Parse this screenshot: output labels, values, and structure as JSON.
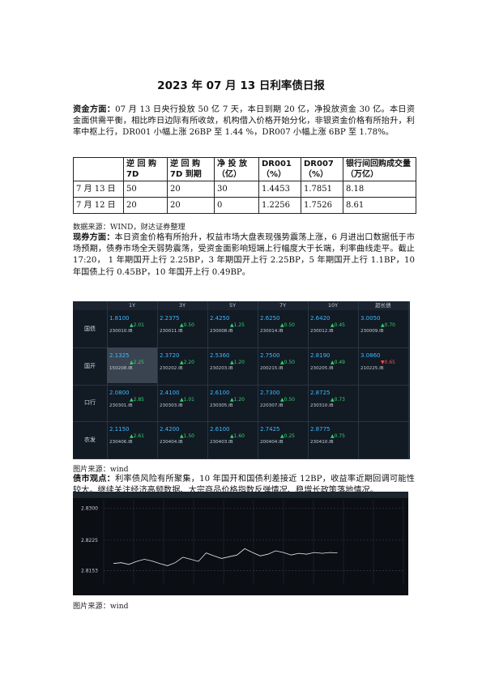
{
  "title": "2023 年 07 月 13 日利率债日报",
  "funds": {
    "lead": "资金方面：",
    "text": "07 月 13 日央行投放 50 亿 7 天，本日到期 20 亿，净投放资金 30 亿。本日资金面供需平衡，相比昨日边际有所收敛，机构借入价格开始分化，非银资金价格有所抬升，利率中枢上行，DR001 小幅上涨 26BP 至 1.44 %，DR007 小幅上涨 6BP 至 1.78%。"
  },
  "rates_table": {
    "headers": [
      "",
      "逆 回 购 7D",
      "逆 回 购 7D 到期",
      "净 投 放（亿）",
      "DR001（%）",
      "DR007（%）",
      "银行间回购成交量（万亿）"
    ],
    "rows": [
      [
        "7 月 13 日",
        "50",
        "20",
        "30",
        "1.4453",
        "1.7851",
        "8.18"
      ],
      [
        "7 月 12 日",
        "20",
        "20",
        "0",
        "1.2256",
        "1.7526",
        "8.61"
      ]
    ]
  },
  "source1": "数据来源：WIND，财达证券整理",
  "spot": {
    "lead": "现券方面：",
    "text": "本日资金价格有所抬升，权益市场大盘表现强势震荡上涨，6 月进出口数据低于市场预期，债券市场全天弱势震荡，受资金面影响短端上行幅度大于长端，利率曲线走平。截止 17:20， 1 年期国开上行 2.25BP，3 年期国开上行 2.25BP，5 年期国开上行 1.1BP，10 年国债上行 0.45BP，10 年国开上行 0.49BP。"
  },
  "quote_panel": {
    "columns": [
      "1Y",
      "3Y",
      "5Y",
      "7Y",
      "10Y",
      "超长债"
    ],
    "rows": [
      {
        "label": "国债",
        "cells": [
          {
            "yield": "1.8100",
            "change": "▲2.01",
            "code": "230010.IB"
          },
          {
            "yield": "2.2375",
            "change": "▲0.50",
            "code": "230011.IB"
          },
          {
            "yield": "2.4250",
            "change": "▲1.25",
            "code": "230008.IB"
          },
          {
            "yield": "2.6250",
            "change": "▲0.50",
            "code": "230014.IB"
          },
          {
            "yield": "2.6420",
            "change": "▲0.45",
            "code": "230012.IB"
          },
          {
            "yield": "3.0050",
            "change": "▲0.70",
            "code": "230009.IB"
          }
        ]
      },
      {
        "label": "国开",
        "cells": [
          {
            "yield": "2.1325",
            "change": "▲2.25",
            "code": "150208.IB"
          },
          {
            "yield": "2.3720",
            "change": "▲2.20",
            "code": "230202.IB"
          },
          {
            "yield": "2.5360",
            "change": "▲1.20",
            "code": "230203.IB"
          },
          {
            "yield": "2.7500",
            "change": "▲0.50",
            "code": "200215.IB"
          },
          {
            "yield": "2.8190",
            "change": "▲0.49",
            "code": "230205.IB"
          },
          {
            "yield": "3.0860",
            "change": "▼0.65",
            "code": "210225.IB"
          }
        ]
      },
      {
        "label": "口行",
        "cells": [
          {
            "yield": "2.0800",
            "change": "▲2.85",
            "code": "230301.IB"
          },
          {
            "yield": "2.4100",
            "change": "▲1.01",
            "code": "230303.IB"
          },
          {
            "yield": "2.6100",
            "change": "▲1.20",
            "code": "230305.IB"
          },
          {
            "yield": "2.7300",
            "change": "▲0.50",
            "code": "220307.IB"
          },
          {
            "yield": "2.8725",
            "change": "▲0.73",
            "code": "230310.IB"
          }
        ]
      },
      {
        "label": "农发",
        "cells": [
          {
            "yield": "2.1150",
            "change": "▲2.61",
            "code": "230406.IB"
          },
          {
            "yield": "2.4200",
            "change": "▲1.50",
            "code": "230404.IB"
          },
          {
            "yield": "2.6100",
            "change": "▲1.60",
            "code": "230403.IB"
          },
          {
            "yield": "2.7425",
            "change": "▲0.25",
            "code": "200404.IB"
          },
          {
            "yield": "2.8775",
            "change": "▲0.75",
            "code": "230410.IB"
          }
        ]
      }
    ]
  },
  "source2": "图片来源：wind",
  "view": {
    "lead": "债市观点：",
    "text": "利率债风险有所聚集，10 年国开和国债利差接近 12BP，收益率近期回调可能性较大。继续关注经济高频数据、大宗商品价格指数反弹情况、稳增长政策落地情况。"
  },
  "chart_data": {
    "type": "line",
    "title": "",
    "ylabel": "",
    "xlabel": "",
    "y_ticks": [
      "2.8300",
      "2.8225",
      "2.8153"
    ],
    "ylim": [
      2.812,
      2.832
    ],
    "grid": true,
    "series": [
      {
        "values": [
          2.817,
          2.8172,
          2.8168,
          2.8175,
          2.818,
          2.8176,
          2.817,
          2.8165,
          2.8172,
          2.8185,
          2.818,
          2.8175,
          2.8195,
          2.8188,
          2.8182,
          2.8186,
          2.819,
          2.8205,
          2.8196,
          2.8188,
          2.8192,
          2.82,
          2.8196,
          2.819,
          2.8194,
          2.8192,
          2.8196,
          2.8194,
          2.8196,
          2.8195
        ]
      }
    ]
  },
  "source3": "图片来源：wind",
  "colors": {
    "up": "#35d06d",
    "down": "#ff4d4d",
    "yield": "#3fb9ff",
    "panel_bg": "#121a24",
    "chart_line": "#e8e8e8"
  }
}
